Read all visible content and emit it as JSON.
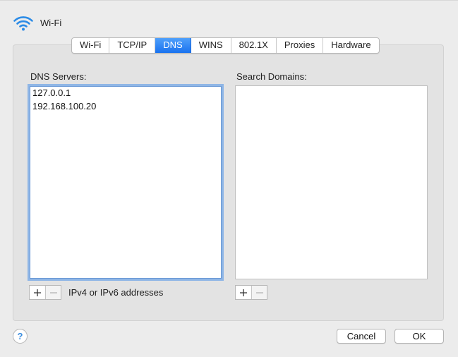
{
  "header": {
    "title": "Wi-Fi",
    "icon": "wifi-icon"
  },
  "tabs": [
    {
      "label": "Wi-Fi",
      "active": false
    },
    {
      "label": "TCP/IP",
      "active": false
    },
    {
      "label": "DNS",
      "active": true
    },
    {
      "label": "WINS",
      "active": false
    },
    {
      "label": "802.1X",
      "active": false
    },
    {
      "label": "Proxies",
      "active": false
    },
    {
      "label": "Hardware",
      "active": false
    }
  ],
  "dns": {
    "label": "DNS Servers:",
    "servers": [
      "127.0.0.1",
      "192.168.100.20"
    ],
    "hint": "IPv4 or IPv6 addresses"
  },
  "search": {
    "label": "Search Domains:",
    "domains": []
  },
  "footer": {
    "help_label": "?",
    "cancel_label": "Cancel",
    "ok_label": "OK"
  },
  "colors": {
    "accent": "#2b82f5",
    "focus_ring": "#8fb6e6"
  }
}
